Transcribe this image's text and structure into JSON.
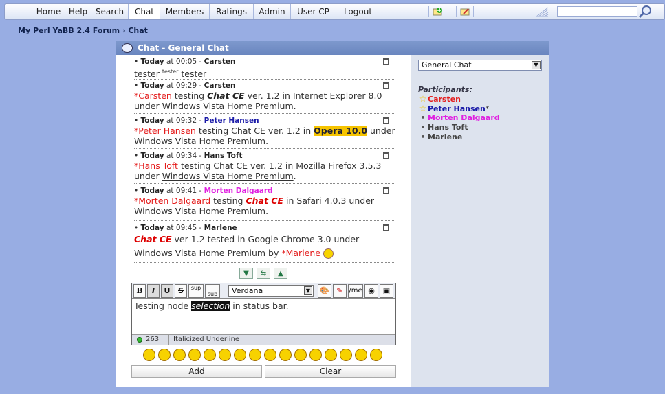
{
  "nav": {
    "items": [
      "Home",
      "Help",
      "Search",
      "Chat",
      "Members",
      "Ratings",
      "Admin",
      "User CP",
      "Logout"
    ],
    "active": "Chat"
  },
  "breadcrumb": "My Perl YaBB 2.4 Forum › Chat",
  "panel_title": "Chat - General Chat",
  "room_select": "General Chat",
  "participants_label": "Participants:",
  "participants": [
    {
      "name": "Carsten",
      "color": "#e41c1c",
      "marker": "star",
      "suffix": ""
    },
    {
      "name": "Peter Hansen",
      "color": "#1a1aa8",
      "marker": "star",
      "suffix": "*"
    },
    {
      "name": "Morten Dalgaard",
      "color": "#e020e0",
      "marker": "dot",
      "suffix": ""
    },
    {
      "name": "Hans Toft",
      "color": "#444444",
      "marker": "dot",
      "suffix": ""
    },
    {
      "name": "Marlene",
      "color": "#444444",
      "marker": "dot",
      "suffix": ""
    }
  ],
  "messages": [
    {
      "day": "Today",
      "at": "at",
      "time": "00:05",
      "dash": "-",
      "user": "Carsten",
      "user_color": "#e41c1c",
      "b1": "tester ",
      "b2": "tester",
      "b3": " tester"
    },
    {
      "day": "Today",
      "at": "at",
      "time": "09:29",
      "dash": "-",
      "user": "Carsten",
      "user_color": "#e41c1c",
      "b1": "*Carsten",
      "b2": " testing ",
      "b3": "Chat CE",
      "b4": " ver. 1.2 in Internet Explorer 8.0 under Windows Vista Home Premium."
    },
    {
      "day": "Today",
      "at": "at",
      "time": "09:32",
      "dash": "-",
      "user": "Peter Hansen",
      "user_color": "#1a1aa8",
      "b1": "*Peter Hansen",
      "b2": " testing Chat CE ver. 1.2 in ",
      "b3": "Opera 10.0",
      "b4": " under Windows Vista Home Premium."
    },
    {
      "day": "Today",
      "at": "at",
      "time": "09:34",
      "dash": "-",
      "user": "Hans Toft",
      "user_color": "#333333",
      "b1": "*Hans Toft",
      "b2": " testing Chat CE ver. 1.2 in Mozilla Firefox 3.5.3 under ",
      "b3": "Windows Vista Home Premium",
      "b4": "."
    },
    {
      "day": "Today",
      "at": "at",
      "time": "09:41",
      "dash": "-",
      "user": "Morten Dalgaard",
      "user_color": "#e020e0",
      "b1": "*Morten Dalgaard",
      "b2": " testing ",
      "b3": "Chat CE",
      "b4": " in Safari 4.0.3 under Windows Vista Home Premium."
    },
    {
      "day": "Today",
      "at": "at",
      "time": "09:45",
      "dash": "-",
      "user": "Marlene",
      "user_color": "#333333",
      "b1": "Chat CE",
      "b2": " ver 1.2 tested in Google Chrome 3.0 under Windows Vista Home Premium by ",
      "b3": "*Marlene"
    }
  ],
  "toolbar": {
    "bold": "B",
    "italic": "I",
    "underline": "U",
    "strike": "S",
    "sup": "sup",
    "sub": "sub",
    "font": "Verdana",
    "me": "/me"
  },
  "input": {
    "before": "Testing node ",
    "selected": "selection",
    "after": " in status bar."
  },
  "status": {
    "count": "263",
    "style": "Italicized Underline"
  },
  "buttons": {
    "add": "Add",
    "clear": "Clear"
  },
  "colors": {
    "background": "#98ade3",
    "header": "#6f8bc4",
    "sidebar": "#dde3ee",
    "accent_red": "#e41c1c"
  }
}
